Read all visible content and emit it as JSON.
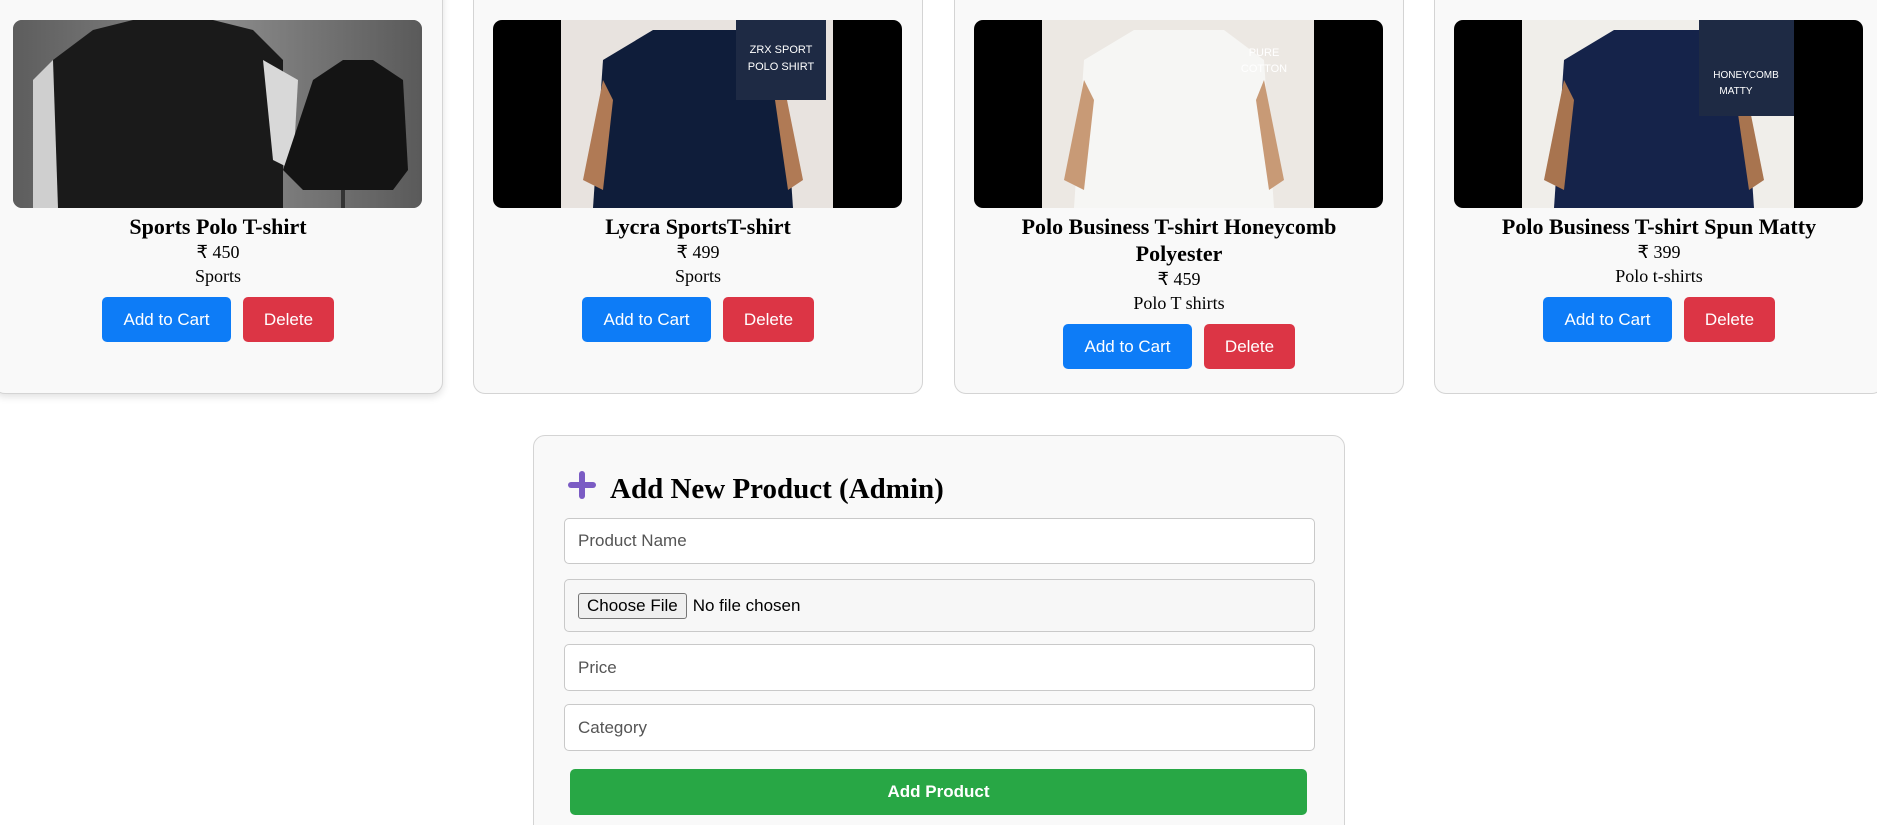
{
  "products": [
    {
      "name": "Sports Polo T-shirt",
      "price": "₹ 450",
      "category": "Sports",
      "image": "black-tshirt-mannequin-image"
    },
    {
      "name": "Lycra SportsT-shirt",
      "price": "₹ 499",
      "category": "Sports",
      "image": "navy-polo-model-image",
      "image_tag": [
        "ZRX SPORT",
        "POLO SHIRT"
      ]
    },
    {
      "name": "Polo Business T-shirt Honeycomb Polyester",
      "price": "₹ 459",
      "category": "Polo T shirts",
      "image": "white-polo-model-image",
      "image_tag": [
        "PURE",
        "COTTON"
      ]
    },
    {
      "name": "Polo Business T-shirt Spun Matty",
      "price": "₹ 399",
      "category": "Polo t-shirts",
      "image": "navy-polo-model-image",
      "image_tag": [
        "HONEYCOMB",
        "MATTY"
      ]
    }
  ],
  "buttons": {
    "add_to_cart": "Add to Cart",
    "delete": "Delete"
  },
  "form": {
    "icon": "plus-icon",
    "title": "Add New Product (Admin)",
    "name_placeholder": "Product Name",
    "file_button": "Choose File",
    "file_status": "No file chosen",
    "price_placeholder": "Price",
    "category_placeholder": "Category",
    "submit": "Add Product"
  },
  "colors": {
    "primary": "#0d7cf7",
    "danger": "#dc3545",
    "success": "#28a745",
    "accent_icon": "#7b5cc4"
  }
}
